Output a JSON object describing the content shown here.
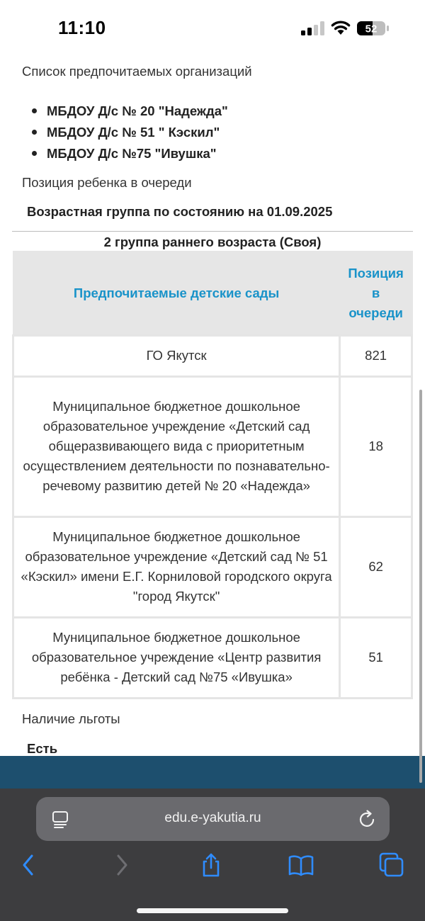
{
  "status_bar": {
    "time": "11:10",
    "battery_level": "52"
  },
  "page": {
    "preferred_orgs_label": "Список предпочитаемых организаций",
    "preferred_orgs": [
      "МБДОУ Д/с № 20 \"Надежда\"",
      "МБДОУ Д/с № 51 \" Кэскил\"",
      "МБДОУ Д/с №75 \"Ивушка\""
    ],
    "queue_position_label": "Позиция ребенка в очереди",
    "age_group_heading": "Возрастная группа по состоянию на 01.09.2025",
    "group_title": "2 группа раннего возраста (Своя)",
    "table": {
      "header_org": "Предпочитаемые детские сады",
      "header_pos": [
        "Позиция",
        "в",
        "очереди"
      ],
      "rows": [
        {
          "org": "ГО Якутск",
          "pos": "821"
        },
        {
          "org": "Муниципальное бюджетное дошкольное образовательное учреждение «Детский сад общеразвивающего вида с приоритетным осуществлением деятельности по познавательно-речевому развитию детей № 20 «Надежда»",
          "pos": "18"
        },
        {
          "org": "Муниципальное бюджетное дошкольное образовательное учреждение «Детский сад № 51 «Кэскил» имени Е.Г. Корниловой городского округа \"город Якутск\"",
          "pos": "62"
        },
        {
          "org": "Муниципальное бюджетное дошкольное образовательное учреждение «Центр развития ребёнка - Детский сад №75 «Ивушка»",
          "pos": "51"
        }
      ]
    },
    "benefit_label": "Наличие льготы",
    "benefit_value": "Есть"
  },
  "browser": {
    "url": "edu.e-yakutia.ru",
    "icons": [
      "tabs-overview-icon",
      "reload-icon",
      "back-icon",
      "forward-icon",
      "share-icon",
      "bookmarks-icon",
      "tabs-icon"
    ]
  },
  "colors": {
    "header_text": "#1a93c9",
    "header_bg": "#e6e6e6",
    "footer_banner": "#1d4f6e",
    "browser_bar": "#3d3d3f",
    "url_field": "#6a6a6e",
    "ios_blue": "#2f8cff"
  }
}
